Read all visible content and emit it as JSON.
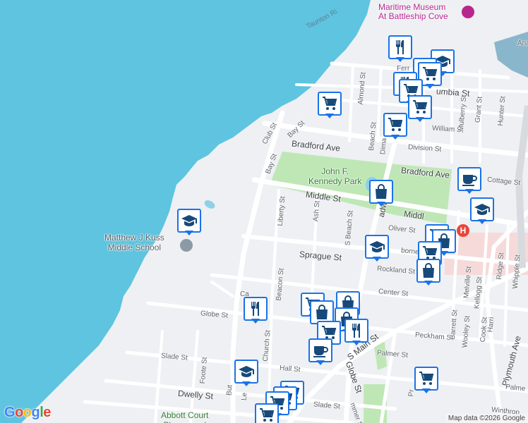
{
  "map": {
    "colors": {
      "water": "#5ec4df",
      "land": "#eef0f3",
      "road": "#ffffff",
      "park": "#bfe7b6",
      "marker_border": "#1a73e8",
      "marker_icon": "#17497a",
      "hospital": "#e8453c",
      "museum": "#b8258f"
    },
    "labels": {
      "water": "Taunton Ri",
      "museum": "Maritime Museum\nAt Battleship Cove",
      "park": "John F.\nKennedy Park",
      "school": "Matthew J Kuss\nMiddle School",
      "playground": "Abbott Court\nPlayground",
      "streets": {
        "bradford_west": "Bradford Ave",
        "bradford_east": "Bradford Ave",
        "middle_a": "Middle St",
        "middle_b": "Middl",
        "sprague": "Sprague St",
        "rockland": "Rockland St",
        "center": "Center St",
        "globe": "Globe St",
        "peckham": "Peckham St",
        "palmer": "Palmer St",
        "hall": "Hall St",
        "slade_a": "Slade St",
        "slade_b": "Slade St",
        "dwelly": "Dwelly St",
        "columbia": "umbia St",
        "william": "William St",
        "division": "Division St",
        "cottage": "Cottage St",
        "oliver": "Oliver St",
        "osborn": "borne St",
        "club": "Club St",
        "bay_a": "Bay St",
        "bay_b": "Bay St",
        "liberty": "Liberty St",
        "ash": "Ash St",
        "s_beach": "S Beach St",
        "beacon": "Beacon St",
        "church": "Church St",
        "foote": "Foote St",
        "almond": "Almond St",
        "beach": "Beach St",
        "dima": "Dima",
        "mulberry": "Mulberry St",
        "grant": "Grant St",
        "hunter": "Hunter St",
        "melville": "Melville St",
        "barrett": "Barrett St",
        "kellogg": "Kellogg St",
        "ridge": "Ridge St",
        "whipple": "Whipple St",
        "wooley": "Wooley St",
        "cook": "Cook St",
        "harrison": "Harri",
        "s_main": "S Main St",
        "globe_diag": "Globe St",
        "plymouth": "Plymouth Ave",
        "broadway": "adway",
        "ferry": "Ferr",
        "ana": "Ana",
        "ca": "Ca",
        "bu": "But",
        "le": "Le",
        "pr": "Pr",
        "winthrop": "Winthrop",
        "palme_e": "Palme",
        "summer": "mmer St"
      }
    },
    "markers": [
      {
        "type": "fork-knife"
      },
      {
        "type": "graduation-cap"
      },
      {
        "type": "cart"
      },
      {
        "type": "cart"
      },
      {
        "type": "fork-knife"
      },
      {
        "type": "cart"
      },
      {
        "type": "cart"
      },
      {
        "type": "cart"
      },
      {
        "type": "cart"
      },
      {
        "type": "shopping-bag"
      },
      {
        "type": "coffee-cup"
      },
      {
        "type": "graduation-cap"
      },
      {
        "type": "graduation-cap"
      },
      {
        "type": "cart"
      },
      {
        "type": "shopping-bag"
      },
      {
        "type": "cart"
      },
      {
        "type": "shopping-bag"
      },
      {
        "type": "graduation-cap"
      },
      {
        "type": "fork-knife"
      },
      {
        "type": "cart"
      },
      {
        "type": "shopping-bag"
      },
      {
        "type": "shopping-bag"
      },
      {
        "type": "shopping-bag"
      },
      {
        "type": "cart"
      },
      {
        "type": "fork-knife"
      },
      {
        "type": "coffee-cup"
      },
      {
        "type": "cart"
      },
      {
        "type": "graduation-cap"
      },
      {
        "type": "cart"
      },
      {
        "type": "cart"
      },
      {
        "type": "cart"
      },
      {
        "type": "cart"
      }
    ]
  },
  "footer": {
    "google_logo": "Google",
    "attribution": "Map data ©2026 Google"
  }
}
